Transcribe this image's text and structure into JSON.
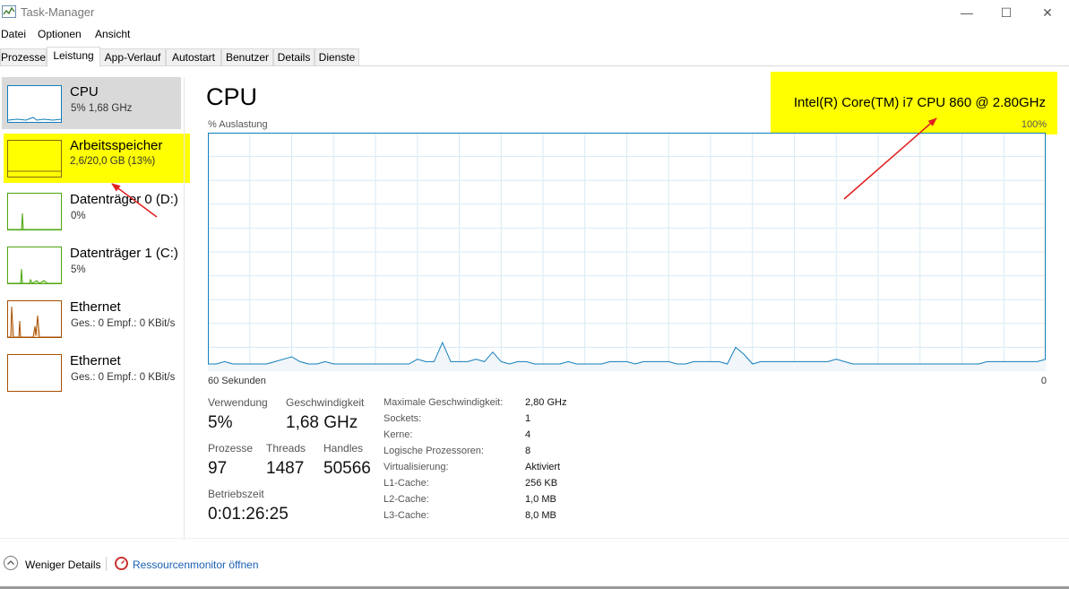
{
  "window": {
    "title": "Task-Manager",
    "controls": {
      "minimize": "—",
      "maximize": "☐",
      "close": "✕"
    }
  },
  "menu": [
    "Datei",
    "Optionen",
    "Ansicht"
  ],
  "tabs": [
    {
      "label": "Prozesse"
    },
    {
      "label": "Leistung",
      "active": true
    },
    {
      "label": "App-Verlauf"
    },
    {
      "label": "Autostart"
    },
    {
      "label": "Benutzer"
    },
    {
      "label": "Details"
    },
    {
      "label": "Dienste"
    }
  ],
  "sidebar": {
    "items": [
      {
        "name": "CPU",
        "value": "5% 1,68 GHz"
      },
      {
        "name": "Arbeitsspeicher",
        "value": "2,6/20,0 GB (13%)"
      },
      {
        "name": "Datenträger 0 (D:)",
        "value": "0%"
      },
      {
        "name": "Datenträger 1 (C:)",
        "value": "5%"
      },
      {
        "name": "Ethernet",
        "value": "Ges.: 0 Empf.: 0 KBit/s"
      },
      {
        "name": "Ethernet",
        "value": "Ges.: 0 Empf.: 0 KBit/s"
      }
    ]
  },
  "main": {
    "title": "CPU",
    "cpu_model": "Intel(R) Core(TM) i7 CPU 860 @ 2.80GHz",
    "util_label": "% Auslastung",
    "util_max": "100%",
    "axis_left": "60 Sekunden",
    "axis_right": "0",
    "stats": {
      "usage_label": "Verwendung",
      "usage_value": "5%",
      "speed_label": "Geschwindigkeit",
      "speed_value": "1,68 GHz",
      "processes_label": "Prozesse",
      "processes_value": "97",
      "threads_label": "Threads",
      "threads_value": "1487",
      "handles_label": "Handles",
      "handles_value": "50566",
      "uptime_label": "Betriebszeit",
      "uptime_value": "0:01:26:25"
    },
    "details": [
      {
        "label": "Maximale Geschwindigkeit:",
        "value": "2,80 GHz"
      },
      {
        "label": "Sockets:",
        "value": "1"
      },
      {
        "label": "Kerne:",
        "value": "4"
      },
      {
        "label": "Logische Prozessoren:",
        "value": "8"
      },
      {
        "label": "Virtualisierung:",
        "value": "Aktiviert"
      },
      {
        "label": "L1-Cache:",
        "value": "256 KB"
      },
      {
        "label": "L2-Cache:",
        "value": "1,0 MB"
      },
      {
        "label": "L3-Cache:",
        "value": "8,0 MB"
      }
    ]
  },
  "footer": {
    "fewer_details": "Weniger Details",
    "resource_monitor": "Ressourcenmonitor öffnen"
  },
  "colors": {
    "cpu": "#117dbb",
    "memory": "#8b12ae",
    "disk": "#4da60c",
    "ethernet": "#a74f01",
    "highlight": "#ffff00",
    "arrow": "#e02020"
  },
  "chart_data": {
    "type": "line",
    "ylim": [
      0,
      100
    ],
    "x_label": "60 Sekunden",
    "series": [
      {
        "values": [
          3,
          3,
          4,
          3,
          3,
          3,
          3,
          3,
          4,
          5,
          6,
          4,
          3,
          3,
          4,
          3,
          3,
          3,
          3,
          3,
          3,
          3,
          3,
          3,
          3,
          5,
          4,
          4,
          12,
          4,
          4,
          4,
          5,
          4,
          8,
          4,
          3,
          4,
          4,
          3,
          3,
          3,
          3,
          4,
          3,
          3,
          3,
          3,
          4,
          4,
          4,
          3,
          4,
          4,
          4,
          4,
          3,
          3,
          4,
          4,
          4,
          4,
          3,
          10,
          7,
          3,
          4,
          4,
          4,
          4,
          4,
          4,
          4,
          4,
          4,
          5,
          4,
          3,
          3,
          3,
          3,
          3,
          3,
          3,
          3,
          3,
          3,
          3,
          3,
          3,
          3,
          3,
          3,
          4,
          4,
          4,
          4,
          4,
          4,
          4,
          5
        ]
      }
    ]
  }
}
